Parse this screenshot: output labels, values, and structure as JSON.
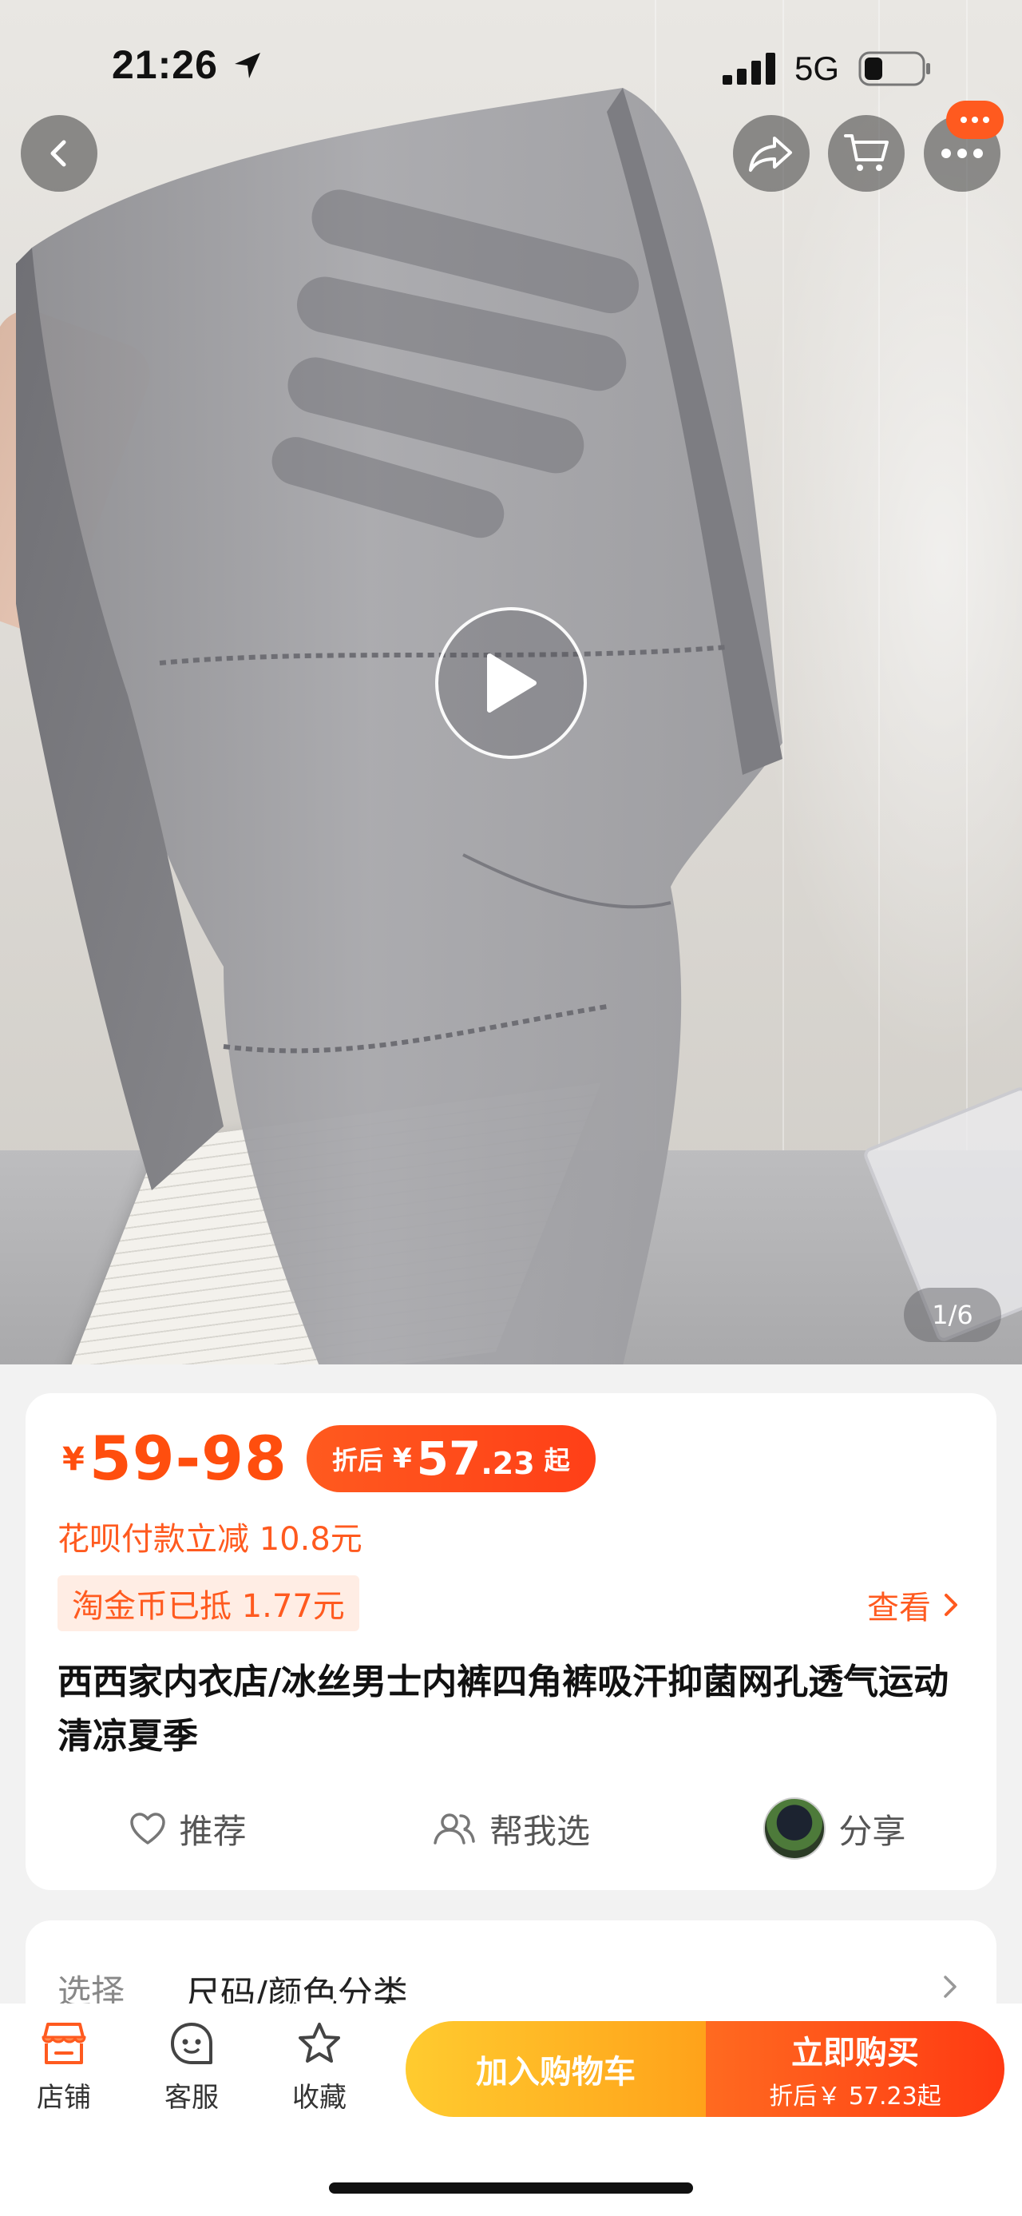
{
  "status_bar": {
    "time": "21:26",
    "network": "5G"
  },
  "gallery": {
    "counter": "1/6"
  },
  "price": {
    "currency": "¥",
    "range": "59-98",
    "discount_prefix": "折后",
    "discount_currency": "¥",
    "discount_int": "57",
    "discount_dec": ".23",
    "discount_suffix": "起"
  },
  "promo": {
    "huabei": "花呗付款立减 10.8元",
    "coin": "淘金币已抵 1.77元",
    "view_link": "查看"
  },
  "product": {
    "title": "西西家内衣店/冰丝男士内裤四角裤吸汗抑菌网孔透气运动清凉夏季"
  },
  "actions": [
    {
      "label": "推荐",
      "icon": "heart-icon"
    },
    {
      "label": "帮我选",
      "icon": "people-icon"
    },
    {
      "label": "分享",
      "icon": "avatar"
    }
  ],
  "select": {
    "label": "选择",
    "value": "尺码/颜色分类"
  },
  "tab_bar": {
    "shop": "店铺",
    "service": "客服",
    "favorite": "收藏",
    "add_to_cart": "加入购物车",
    "buy_now": "立即购买",
    "buy_now_sub": "折后￥ 57.23起"
  },
  "colors": {
    "accent": "#ff4e0e",
    "cart_button": "#ffb224",
    "buy_button": "#ff4a16"
  }
}
